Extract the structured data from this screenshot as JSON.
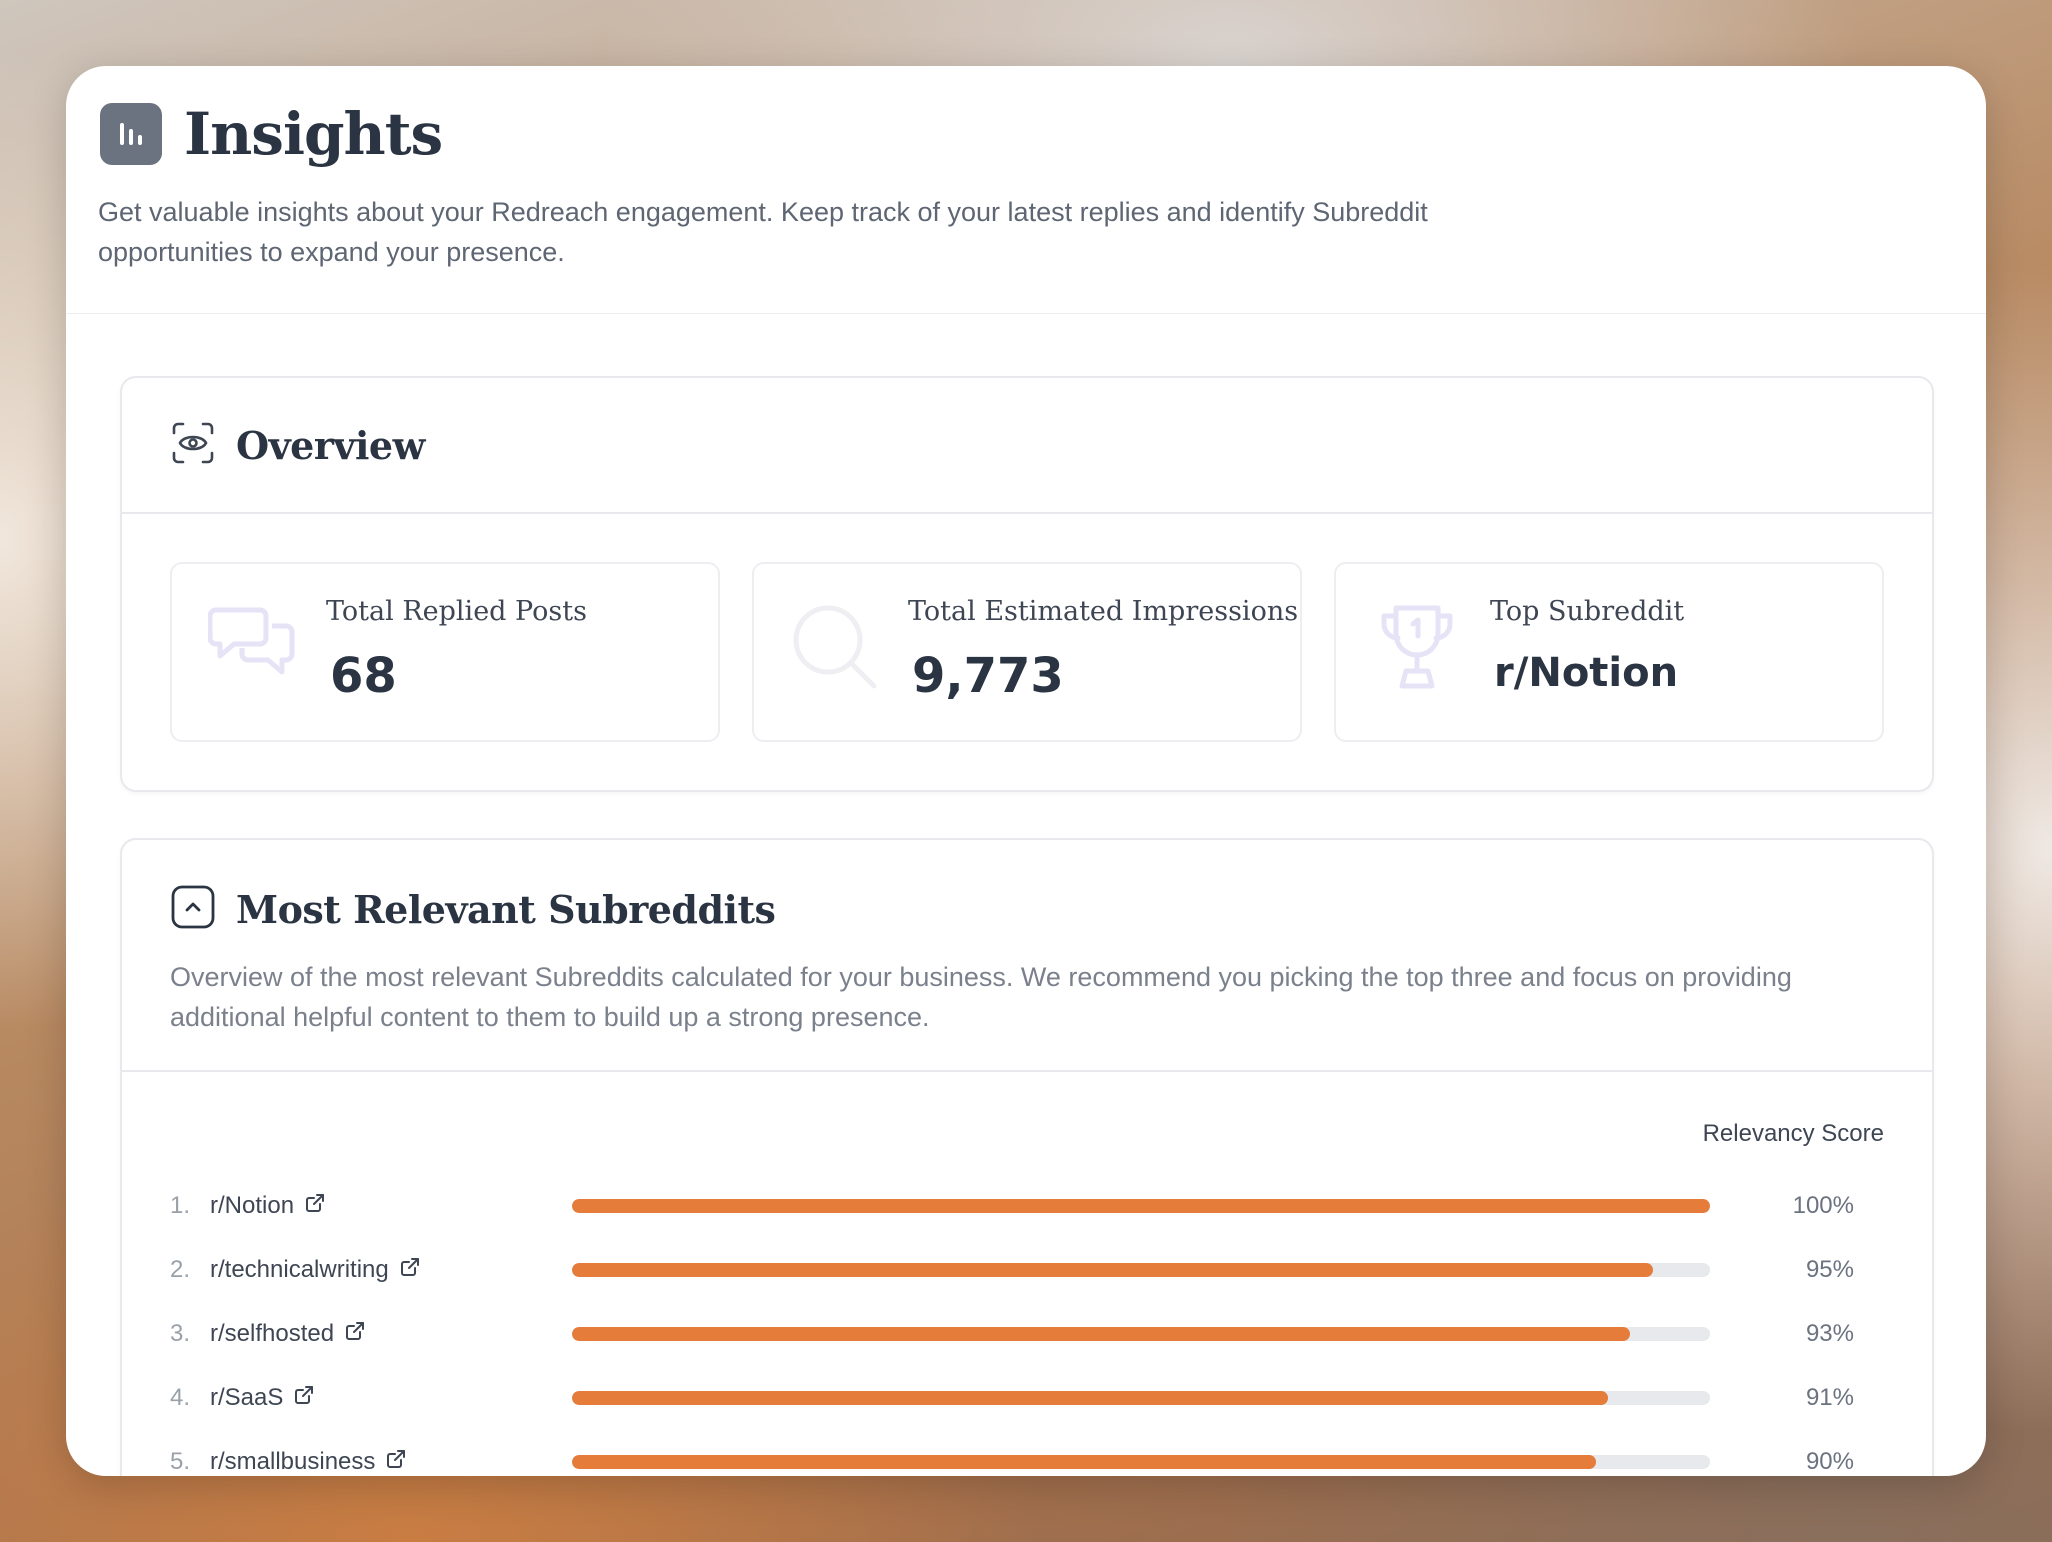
{
  "header": {
    "title": "Insights",
    "icon": "bar-chart-icon",
    "description": "Get valuable insights about your Redreach engagement. Keep track of your latest replies and identify Subreddit opportunities to expand your presence."
  },
  "overview": {
    "title": "Overview",
    "icon": "eye-scan-icon",
    "stats": [
      {
        "label": "Total Replied Posts",
        "value": "68",
        "icon": "chat-bubbles-icon"
      },
      {
        "label": "Total Estimated Impressions",
        "value": "9,773",
        "icon": "search-icon"
      },
      {
        "label": "Top Subreddit",
        "value": "r/Notion",
        "icon": "trophy-icon"
      }
    ]
  },
  "relevant": {
    "title": "Most Relevant Subreddits",
    "icon": "chevron-up-square-icon",
    "description": "Overview of the most relevant Subreddits calculated for your business. We recommend you picking the top three and focus on providing additional helpful content to them to build up a strong presence.",
    "score_header": "Relevancy Score",
    "accent_color": "#e57c3a",
    "rows": [
      {
        "rank": "1.",
        "name": "r/Notion",
        "score": 100,
        "score_label": "100%"
      },
      {
        "rank": "2.",
        "name": "r/technicalwriting",
        "score": 95,
        "score_label": "95%"
      },
      {
        "rank": "3.",
        "name": "r/selfhosted",
        "score": 93,
        "score_label": "93%"
      },
      {
        "rank": "4.",
        "name": "r/SaaS",
        "score": 91,
        "score_label": "91%"
      },
      {
        "rank": "5.",
        "name": "r/smallbusiness",
        "score": 90,
        "score_label": "90%"
      }
    ]
  }
}
